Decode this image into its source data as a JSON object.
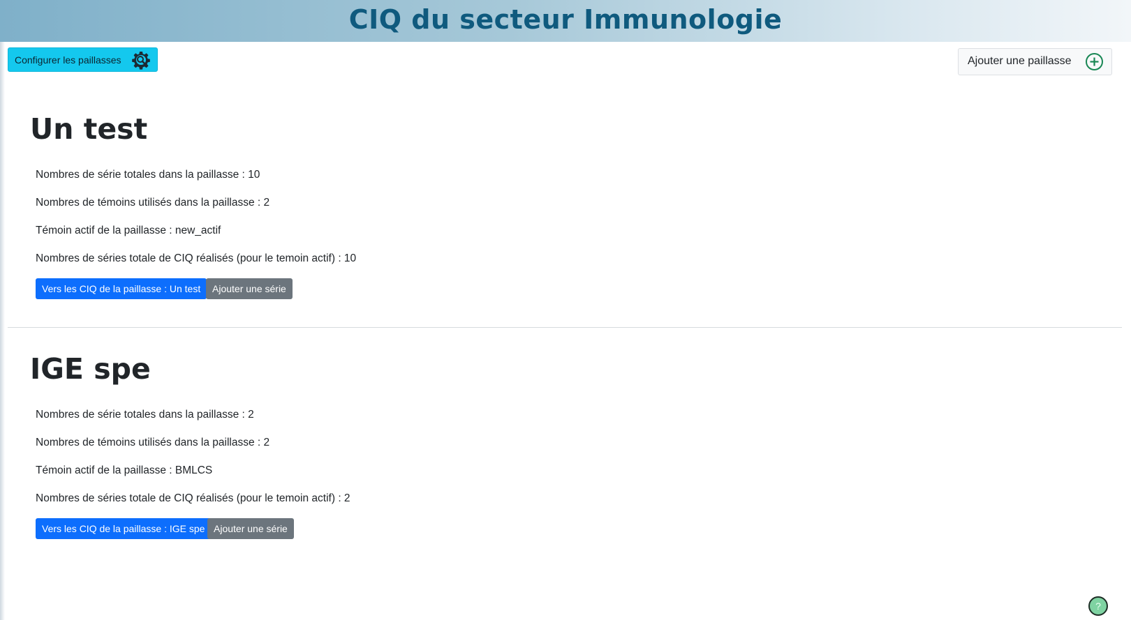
{
  "header": {
    "title": "CIQ du secteur Immunologie"
  },
  "toolbar": {
    "configure_label": "Configurer les paillasses",
    "configure_icon": "gear-search-icon",
    "add_label": "Ajouter une paillasse",
    "add_icon": "plus-circle-icon"
  },
  "paillasses": [
    {
      "name": "Un test",
      "total_series": "Nombres de série totales dans la paillasse : 10",
      "temoins_count": "Nombres de témoins utilisés dans la paillasse : 2",
      "temoin_actif": "Témoin actif de la paillasse : new_actif",
      "ciq_series": "Nombres de séries totale de CIQ réalisés (pour le temoin actif) : 10",
      "goto_label": "Vers les CIQ de la paillasse : Un test",
      "add_series_label": "Ajouter une série"
    },
    {
      "name": "IGE spe",
      "total_series": "Nombres de série totales dans la paillasse : 2",
      "temoins_count": "Nombres de témoins utilisés dans la paillasse : 2",
      "temoin_actif": "Témoin actif de la paillasse : BMLCS",
      "ciq_series": "Nombres de séries totale de CIQ réalisés (pour le temoin actif) : 2",
      "goto_label": "Vers les CIQ de la paillasse : IGE spe",
      "add_series_label": "Ajouter une série"
    }
  ],
  "help": {
    "label": "?",
    "icon": "help-icon"
  },
  "colors": {
    "header_title": "#0f5a7e",
    "config_button": "#14c8ee",
    "primary_button": "#0d6efd",
    "secondary_button": "#6c757d",
    "help_button": "#7fd3a2"
  }
}
